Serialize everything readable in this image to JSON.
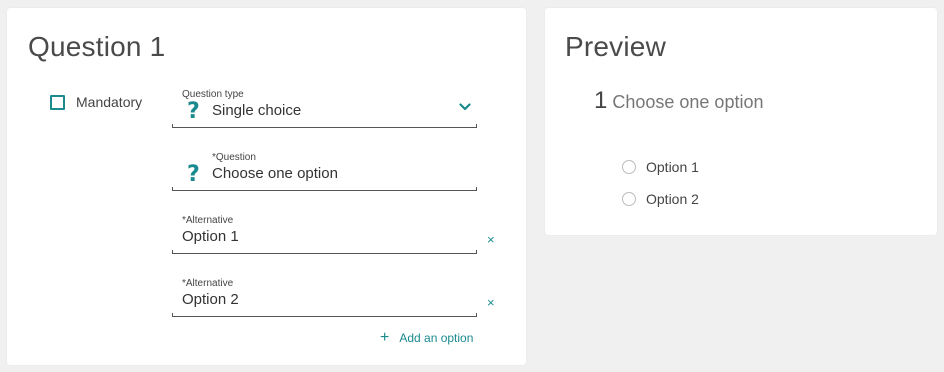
{
  "editor": {
    "title": "Question 1",
    "mandatory_label": "Mandatory",
    "question_type": {
      "label": "Question type",
      "value": "Single choice"
    },
    "question": {
      "label": "*Question",
      "value": "Choose one option"
    },
    "alternatives": [
      {
        "label": "*Alternative",
        "value": "Option 1"
      },
      {
        "label": "*Alternative",
        "value": "Option 2"
      }
    ],
    "remove_symbol": "×",
    "add_option": {
      "plus": "+",
      "label": "Add an option"
    }
  },
  "preview": {
    "title": "Preview",
    "question_number": "1",
    "question_text": "Choose one option",
    "options": [
      "Option 1",
      "Option 2"
    ]
  },
  "colors": {
    "accent": "#1b8a8f",
    "background": "#f0f0f0",
    "card": "#ffffff"
  },
  "icons": {
    "question": "question-mark-icon",
    "chevron": "chevron-down-icon",
    "remove": "close-icon",
    "add": "plus-icon"
  }
}
